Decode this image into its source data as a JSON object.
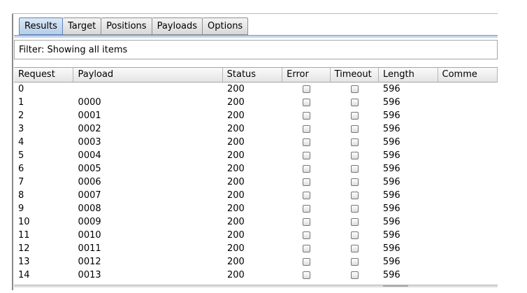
{
  "tabs": [
    "Results",
    "Target",
    "Positions",
    "Payloads",
    "Options"
  ],
  "active_tab": 0,
  "filter": {
    "text": "Filter: Showing all items"
  },
  "table": {
    "columns": [
      "Request",
      "Payload",
      "Status",
      "Error",
      "Timeout",
      "Length",
      "Comme"
    ],
    "rows": [
      {
        "request": "0",
        "payload": "",
        "status": "200",
        "error": false,
        "timeout": false,
        "length": "596",
        "comment": ""
      },
      {
        "request": "1",
        "payload": "0000",
        "status": "200",
        "error": false,
        "timeout": false,
        "length": "596",
        "comment": ""
      },
      {
        "request": "2",
        "payload": "0001",
        "status": "200",
        "error": false,
        "timeout": false,
        "length": "596",
        "comment": ""
      },
      {
        "request": "3",
        "payload": "0002",
        "status": "200",
        "error": false,
        "timeout": false,
        "length": "596",
        "comment": ""
      },
      {
        "request": "4",
        "payload": "0003",
        "status": "200",
        "error": false,
        "timeout": false,
        "length": "596",
        "comment": ""
      },
      {
        "request": "5",
        "payload": "0004",
        "status": "200",
        "error": false,
        "timeout": false,
        "length": "596",
        "comment": ""
      },
      {
        "request": "6",
        "payload": "0005",
        "status": "200",
        "error": false,
        "timeout": false,
        "length": "596",
        "comment": ""
      },
      {
        "request": "7",
        "payload": "0006",
        "status": "200",
        "error": false,
        "timeout": false,
        "length": "596",
        "comment": ""
      },
      {
        "request": "8",
        "payload": "0007",
        "status": "200",
        "error": false,
        "timeout": false,
        "length": "596",
        "comment": ""
      },
      {
        "request": "9",
        "payload": "0008",
        "status": "200",
        "error": false,
        "timeout": false,
        "length": "596",
        "comment": ""
      },
      {
        "request": "10",
        "payload": "0009",
        "status": "200",
        "error": false,
        "timeout": false,
        "length": "596",
        "comment": ""
      },
      {
        "request": "11",
        "payload": "0010",
        "status": "200",
        "error": false,
        "timeout": false,
        "length": "596",
        "comment": ""
      },
      {
        "request": "12",
        "payload": "0011",
        "status": "200",
        "error": false,
        "timeout": false,
        "length": "596",
        "comment": ""
      },
      {
        "request": "13",
        "payload": "0012",
        "status": "200",
        "error": false,
        "timeout": false,
        "length": "596",
        "comment": ""
      },
      {
        "request": "14",
        "payload": "0013",
        "status": "200",
        "error": false,
        "timeout": false,
        "length": "596",
        "comment": ""
      }
    ]
  }
}
